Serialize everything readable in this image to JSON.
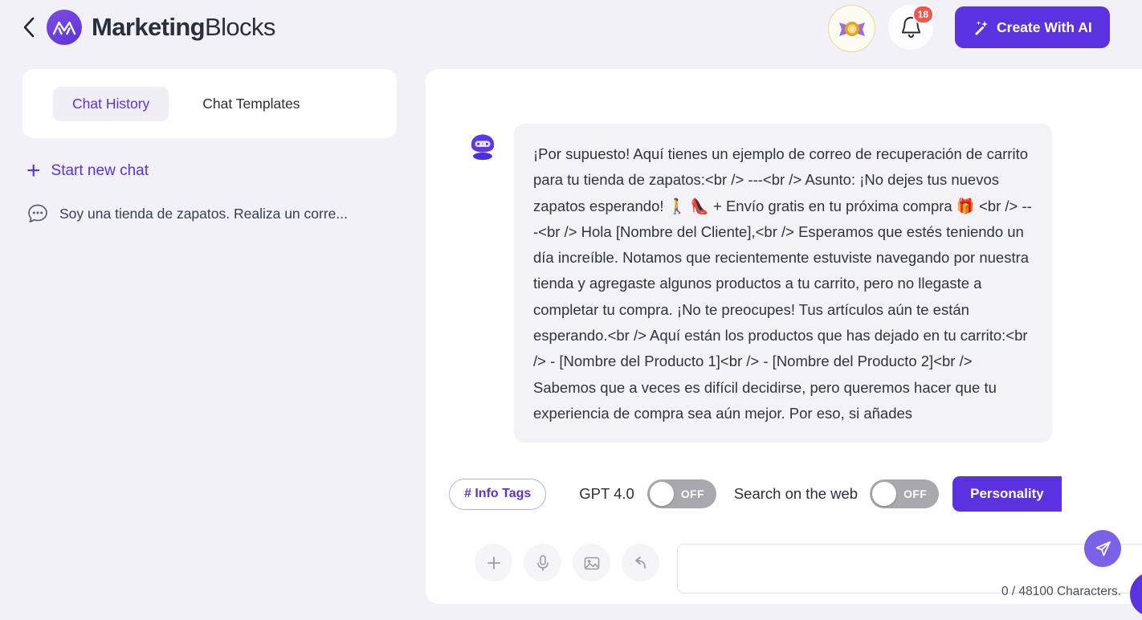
{
  "header": {
    "back_icon": "chevron-left-icon",
    "brand_name_bold": "Marketing",
    "brand_name_light": "Blocks",
    "logo_icon": "marketingblocks-logo-icon",
    "rewards_icon": "rewards-rosette-icon",
    "notification_icon": "bell-icon",
    "notification_count": "18",
    "create_button_label": "Create With AI",
    "create_button_icon": "magic-wand-icon",
    "accent_color": "#5b32e0",
    "badge_color": "#f2554d"
  },
  "sidebar": {
    "tabs": [
      {
        "label": "Chat History",
        "active": true
      },
      {
        "label": "Chat Templates",
        "active": false
      }
    ],
    "start_new_chat": {
      "label": "Start new chat",
      "icon": "plus-icon"
    },
    "history": [
      {
        "label": "Soy una tienda de zapatos. Realiza un corre...",
        "icon": "chat-bubble-dots-icon"
      }
    ]
  },
  "chat": {
    "messages": [
      {
        "role": "assistant",
        "avatar_icon": "robot-avatar-icon",
        "text": "¡Por supuesto! Aquí tienes un ejemplo de correo de recuperación de carrito para tu tienda de zapatos:<br /> ---<br /> Asunto: ¡No dejes tus nuevos zapatos esperando! 🚶 👠 + Envío gratis en tu próxima compra 🎁 <br /> ---<br /> Hola [Nombre del Cliente],<br /> Esperamos que estés teniendo un día increíble. Notamos que recientemente estuviste navegando por nuestra tienda y agregaste algunos productos a tu carrito, pero no llegaste a completar tu compra. ¡No te preocupes! Tus artículos aún te están esperando.<br /> Aquí están los productos que has dejado en tu carrito:<br /> - [Nombre del Producto 1]<br /> - [Nombre del Producto 2]<br /> Sabemos que a veces es difícil decidirse, pero queremos hacer que tu experiencia de compra sea aún mejor. Por eso, si añades"
      }
    ]
  },
  "options_bar": {
    "info_tags_label": "# Info Tags",
    "gpt_label": "GPT 4.0",
    "gpt_toggle_state": "OFF",
    "search_web_label": "Search on the web",
    "search_web_toggle_state": "OFF",
    "personality_label": "Personality"
  },
  "composer": {
    "tools": [
      {
        "icon": "plus-icon",
        "name": "add-attachment-button"
      },
      {
        "icon": "microphone-icon",
        "name": "voice-input-button"
      },
      {
        "icon": "image-icon",
        "name": "image-upload-button"
      },
      {
        "icon": "undo-arrow-icon",
        "name": "undo-button"
      }
    ],
    "input_value": "",
    "input_placeholder": "",
    "send_icon": "send-paper-plane-icon",
    "character_count": "0 / 48100 Characters."
  },
  "floating_button": {
    "icon": "support-chat-fab-icon"
  }
}
